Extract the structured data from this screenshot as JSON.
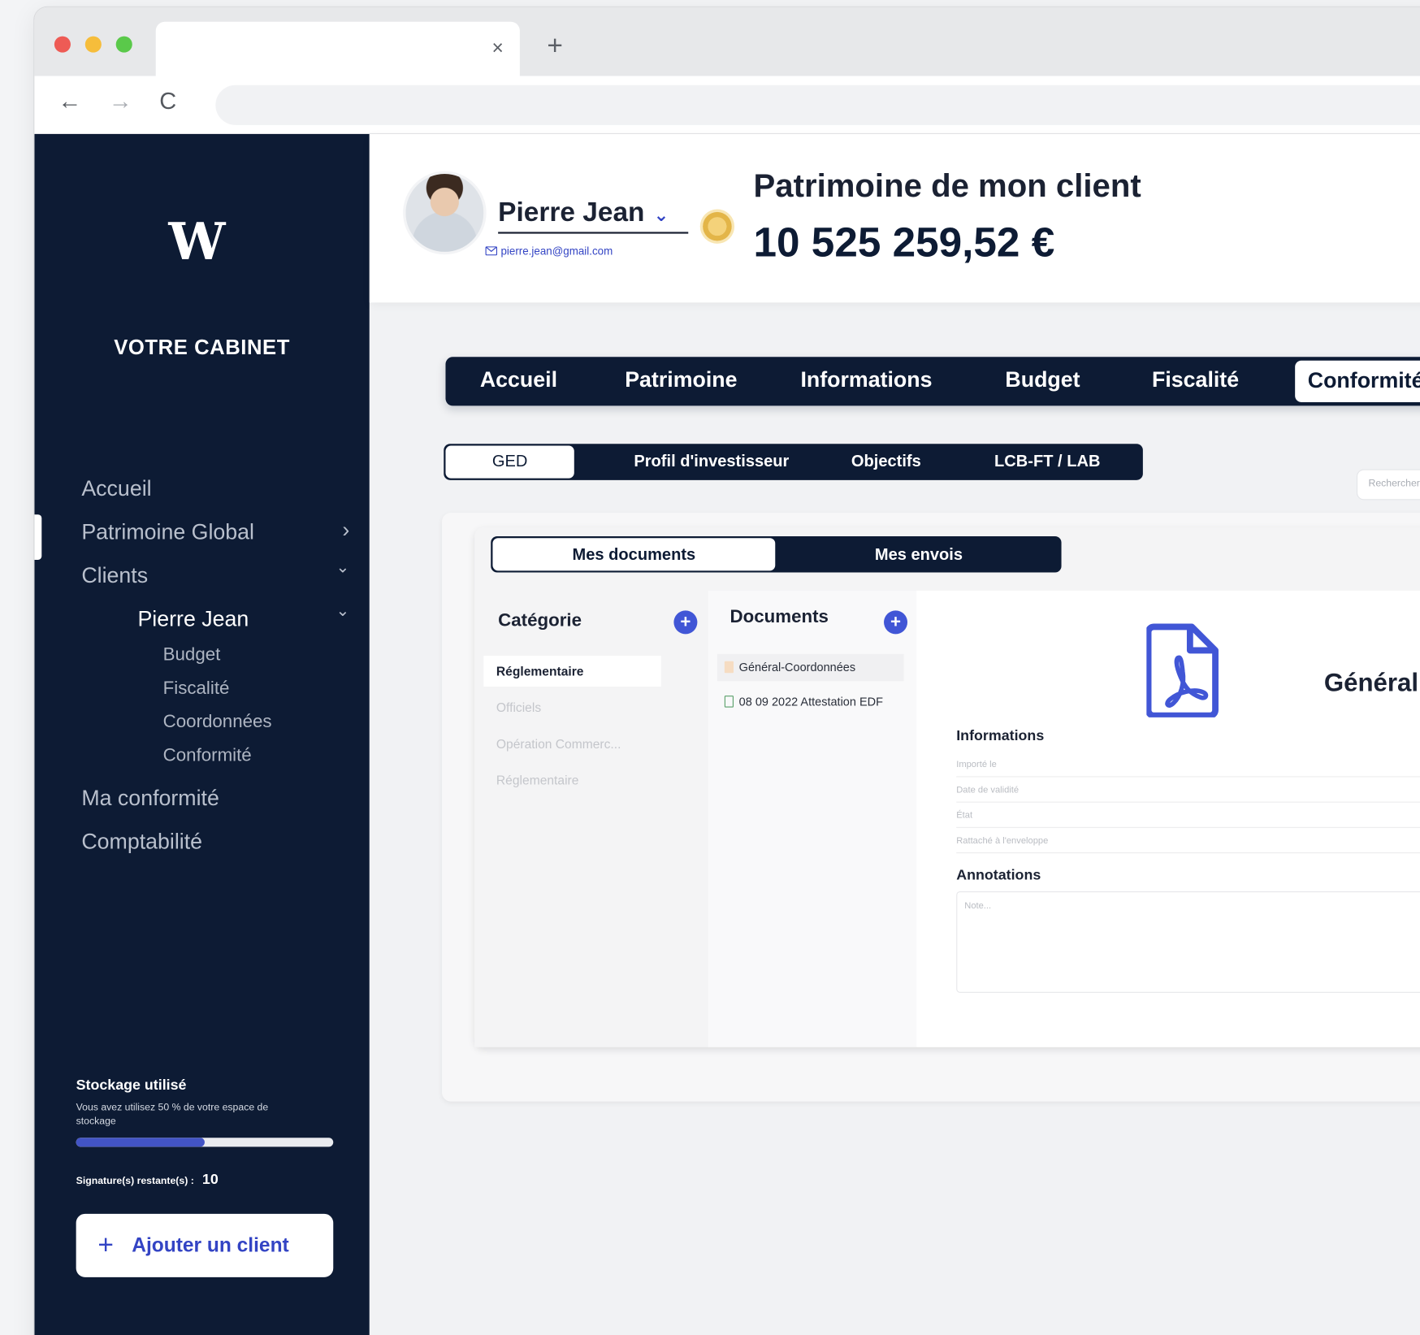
{
  "browser": {
    "tab_title": "",
    "tab_close": "×",
    "new_tab": "+",
    "back": "←",
    "forward": "→",
    "reload": "C"
  },
  "sidebar": {
    "logo": "W",
    "cabinet": "VOTRE CABINET",
    "items": [
      {
        "label": "Accueil"
      },
      {
        "label": "Patrimoine Global",
        "chevron": "›"
      },
      {
        "label": "Clients",
        "chevron": "⌄"
      },
      {
        "label": "Pierre Jean",
        "chevron": "⌄"
      },
      {
        "label": "Budget"
      },
      {
        "label": "Fiscalité"
      },
      {
        "label": "Coordonnées"
      },
      {
        "label": "Conformité"
      },
      {
        "label": "Ma conformité"
      },
      {
        "label": "Comptabilité"
      }
    ],
    "storage": {
      "title": "Stockage utilisé",
      "text": "Vous avez utilisez 50 % de votre espace de stockage",
      "used_fraction": 0.5
    },
    "signatures_label": "Signature(s) restante(s) :",
    "signatures_value": "10",
    "add_client": "Ajouter un client",
    "add_client_plus": "+"
  },
  "header": {
    "client_name": "Pierre Jean",
    "client_dropdown": "⌄",
    "client_email": "pierre.jean@gmail.com",
    "patrimoine_label": "Patrimoine de mon client",
    "patrimoine_value": "10 525 259,52 €"
  },
  "top_tabs": [
    {
      "label": "Accueil"
    },
    {
      "label": "Patrimoine"
    },
    {
      "label": "Informations"
    },
    {
      "label": "Budget"
    },
    {
      "label": "Fiscalité"
    },
    {
      "label": "Conformité",
      "active": true
    }
  ],
  "sub_tabs": [
    {
      "label": "GED",
      "active": true
    },
    {
      "label": "Profil d'investisseur"
    },
    {
      "label": "Objectifs"
    },
    {
      "label": "LCB-FT / LAB"
    }
  ],
  "search": {
    "placeholder": "Rechercher"
  },
  "doc_tabs": [
    {
      "label": "Mes documents",
      "active": true
    },
    {
      "label": "Mes envois"
    }
  ],
  "categories": {
    "header": "Catégorie",
    "add": "+",
    "items": [
      {
        "label": "Réglementaire",
        "active": true
      },
      {
        "label": "Officiels"
      },
      {
        "label": "Opération Commerc..."
      },
      {
        "label": "Réglementaire"
      }
    ]
  },
  "documents": {
    "header": "Documents",
    "add": "+",
    "items": [
      {
        "label": "Général-Coordonnées",
        "active": true
      },
      {
        "label": "08 09 2022 Attestation EDF"
      }
    ]
  },
  "detail": {
    "title": "Général",
    "informations_header": "Informations",
    "fields": [
      "Importé le",
      "Date de validité",
      "État",
      "Rattaché à l'enveloppe"
    ],
    "annotations_header": "Annotations",
    "notes_placeholder": "Note..."
  },
  "colors": {
    "navy": "#0d1b34",
    "accent_blue": "#4156d6",
    "background": "#f1f2f4"
  }
}
